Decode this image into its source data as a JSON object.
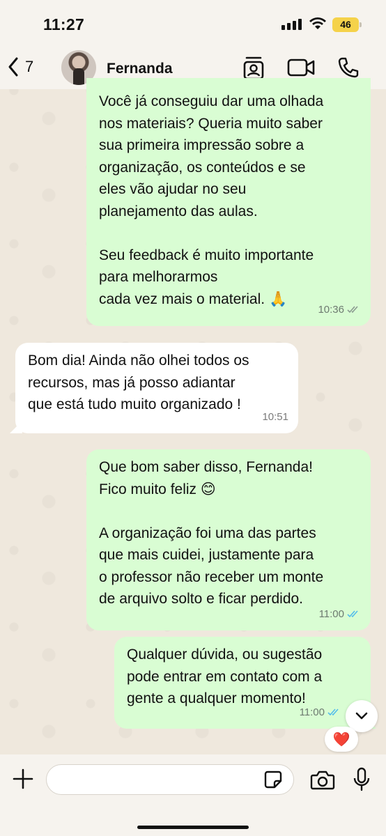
{
  "status_bar": {
    "time": "11:27",
    "battery": "46"
  },
  "header": {
    "back_count": "7",
    "contact_name": "Fernanda",
    "icons": [
      "chevron-left-icon",
      "contact-card-icon",
      "video-call-icon",
      "phone-icon"
    ]
  },
  "messages": [
    {
      "direction": "outgoing",
      "text": "Você já conseguiu dar uma olhada\nnos materiais? Queria muito saber\nsua primeira impressão sobre a\norganização, os conteúdos e se\neles vão ajudar no seu\nplanejamento das aulas.\n\nSeu feedback é muito importante\npara melhorarmos\ncada vez mais o material.",
      "emoji": "🙏",
      "time": "10:36",
      "status": "read"
    },
    {
      "direction": "incoming",
      "text": "Bom dia! Ainda não olhei todos os\nrecursos, mas já posso adiantar\nque está tudo muito organizado !",
      "time": "10:51"
    },
    {
      "direction": "outgoing",
      "text": "Que bom saber disso, Fernanda!\nFico muito feliz",
      "emoji": "😊",
      "text_continued": "A organização foi uma das partes\nque mais cuidei, justamente para\no professor não receber um monte\nde arquivo solto e ficar perdido.",
      "time": "11:00",
      "status": "read"
    },
    {
      "direction": "outgoing",
      "text": "Qualquer dúvida, ou sugestão\npode entrar em contato com a\ngente a qualquer momento!",
      "time": "11:00",
      "status": "read",
      "reaction": "❤️"
    }
  ],
  "composer": {
    "placeholder": ""
  },
  "colors": {
    "outgoing_bubble": "#d9fdd3",
    "incoming_bubble": "#ffffff",
    "read_ticks": "#53bdeb",
    "wallpaper": "#efe8dd",
    "battery": "#f5d24a"
  }
}
